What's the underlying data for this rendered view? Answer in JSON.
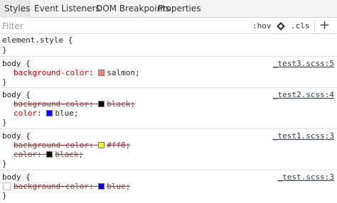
{
  "tabs": [
    {
      "label": "Styles",
      "active": true
    },
    {
      "label": "Event Listeners",
      "active": false
    },
    {
      "label": "DOM Breakpoints",
      "active": false
    },
    {
      "label": "Properties",
      "active": false
    }
  ],
  "filter": {
    "placeholder": "Filter",
    "hov_label": ":hov",
    "cls_label": ".cls",
    "new_rule_label": "+"
  },
  "element_style": {
    "selector": "element.style {",
    "close": "}"
  },
  "rules": [
    {
      "selector": "body {",
      "source": "_test3.scss:5",
      "close": "}",
      "declarations": [
        {
          "property": "background-color",
          "colon": ":",
          "value": "salmon",
          "semicolon": ";",
          "swatch": "#fa8072",
          "overridden": false
        }
      ]
    },
    {
      "selector": "body {",
      "source": "_test2.scss:4",
      "close": "}",
      "declarations": [
        {
          "property": "background-color",
          "colon": ":",
          "value": "black",
          "semicolon": ";",
          "swatch": "#000000",
          "overridden": true
        },
        {
          "property": "color",
          "colon": ":",
          "value": "blue",
          "semicolon": ";",
          "swatch": "#0000ff",
          "overridden": false
        }
      ]
    },
    {
      "selector": "body {",
      "source": "_test1.scss:3",
      "close": "}",
      "declarations": [
        {
          "property": "background-color",
          "colon": ":",
          "value": "#ff0",
          "semicolon": ";",
          "swatch": "#ffff00",
          "overridden": true
        },
        {
          "property": "color",
          "colon": ":",
          "value": "black",
          "semicolon": ";",
          "swatch": "#000000",
          "overridden": true
        }
      ]
    },
    {
      "selector": "body {",
      "source": "_test.scss:3",
      "close": "}",
      "declarations": [
        {
          "property": "background-color",
          "colon": ":",
          "value": "blue",
          "semicolon": ";",
          "swatch": "#0000ff",
          "overridden": true
        }
      ]
    }
  ]
}
